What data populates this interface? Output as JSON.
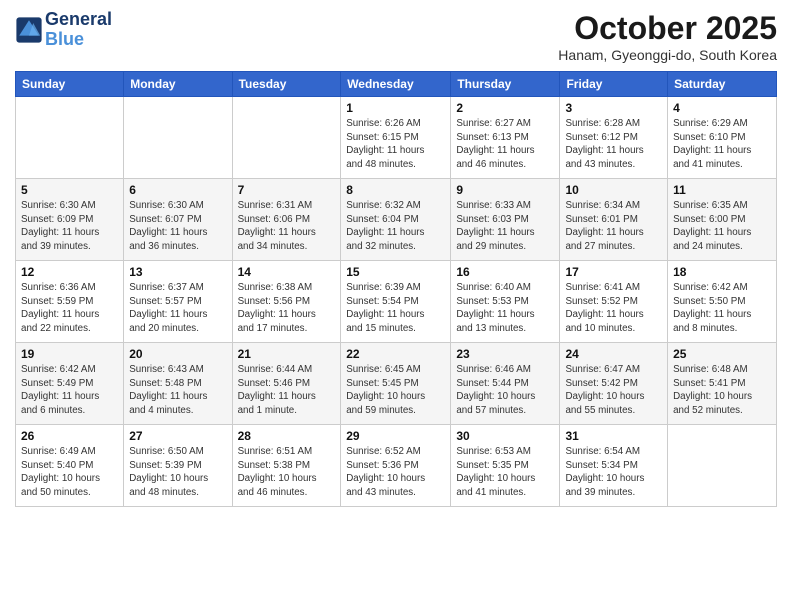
{
  "header": {
    "logo_line1": "General",
    "logo_line2": "Blue",
    "month_title": "October 2025",
    "subtitle": "Hanam, Gyeonggi-do, South Korea"
  },
  "days_of_week": [
    "Sunday",
    "Monday",
    "Tuesday",
    "Wednesday",
    "Thursday",
    "Friday",
    "Saturday"
  ],
  "weeks": [
    [
      {
        "day": "",
        "info": ""
      },
      {
        "day": "",
        "info": ""
      },
      {
        "day": "",
        "info": ""
      },
      {
        "day": "1",
        "info": "Sunrise: 6:26 AM\nSunset: 6:15 PM\nDaylight: 11 hours\nand 48 minutes."
      },
      {
        "day": "2",
        "info": "Sunrise: 6:27 AM\nSunset: 6:13 PM\nDaylight: 11 hours\nand 46 minutes."
      },
      {
        "day": "3",
        "info": "Sunrise: 6:28 AM\nSunset: 6:12 PM\nDaylight: 11 hours\nand 43 minutes."
      },
      {
        "day": "4",
        "info": "Sunrise: 6:29 AM\nSunset: 6:10 PM\nDaylight: 11 hours\nand 41 minutes."
      }
    ],
    [
      {
        "day": "5",
        "info": "Sunrise: 6:30 AM\nSunset: 6:09 PM\nDaylight: 11 hours\nand 39 minutes."
      },
      {
        "day": "6",
        "info": "Sunrise: 6:30 AM\nSunset: 6:07 PM\nDaylight: 11 hours\nand 36 minutes."
      },
      {
        "day": "7",
        "info": "Sunrise: 6:31 AM\nSunset: 6:06 PM\nDaylight: 11 hours\nand 34 minutes."
      },
      {
        "day": "8",
        "info": "Sunrise: 6:32 AM\nSunset: 6:04 PM\nDaylight: 11 hours\nand 32 minutes."
      },
      {
        "day": "9",
        "info": "Sunrise: 6:33 AM\nSunset: 6:03 PM\nDaylight: 11 hours\nand 29 minutes."
      },
      {
        "day": "10",
        "info": "Sunrise: 6:34 AM\nSunset: 6:01 PM\nDaylight: 11 hours\nand 27 minutes."
      },
      {
        "day": "11",
        "info": "Sunrise: 6:35 AM\nSunset: 6:00 PM\nDaylight: 11 hours\nand 24 minutes."
      }
    ],
    [
      {
        "day": "12",
        "info": "Sunrise: 6:36 AM\nSunset: 5:59 PM\nDaylight: 11 hours\nand 22 minutes."
      },
      {
        "day": "13",
        "info": "Sunrise: 6:37 AM\nSunset: 5:57 PM\nDaylight: 11 hours\nand 20 minutes."
      },
      {
        "day": "14",
        "info": "Sunrise: 6:38 AM\nSunset: 5:56 PM\nDaylight: 11 hours\nand 17 minutes."
      },
      {
        "day": "15",
        "info": "Sunrise: 6:39 AM\nSunset: 5:54 PM\nDaylight: 11 hours\nand 15 minutes."
      },
      {
        "day": "16",
        "info": "Sunrise: 6:40 AM\nSunset: 5:53 PM\nDaylight: 11 hours\nand 13 minutes."
      },
      {
        "day": "17",
        "info": "Sunrise: 6:41 AM\nSunset: 5:52 PM\nDaylight: 11 hours\nand 10 minutes."
      },
      {
        "day": "18",
        "info": "Sunrise: 6:42 AM\nSunset: 5:50 PM\nDaylight: 11 hours\nand 8 minutes."
      }
    ],
    [
      {
        "day": "19",
        "info": "Sunrise: 6:42 AM\nSunset: 5:49 PM\nDaylight: 11 hours\nand 6 minutes."
      },
      {
        "day": "20",
        "info": "Sunrise: 6:43 AM\nSunset: 5:48 PM\nDaylight: 11 hours\nand 4 minutes."
      },
      {
        "day": "21",
        "info": "Sunrise: 6:44 AM\nSunset: 5:46 PM\nDaylight: 11 hours\nand 1 minute."
      },
      {
        "day": "22",
        "info": "Sunrise: 6:45 AM\nSunset: 5:45 PM\nDaylight: 10 hours\nand 59 minutes."
      },
      {
        "day": "23",
        "info": "Sunrise: 6:46 AM\nSunset: 5:44 PM\nDaylight: 10 hours\nand 57 minutes."
      },
      {
        "day": "24",
        "info": "Sunrise: 6:47 AM\nSunset: 5:42 PM\nDaylight: 10 hours\nand 55 minutes."
      },
      {
        "day": "25",
        "info": "Sunrise: 6:48 AM\nSunset: 5:41 PM\nDaylight: 10 hours\nand 52 minutes."
      }
    ],
    [
      {
        "day": "26",
        "info": "Sunrise: 6:49 AM\nSunset: 5:40 PM\nDaylight: 10 hours\nand 50 minutes."
      },
      {
        "day": "27",
        "info": "Sunrise: 6:50 AM\nSunset: 5:39 PM\nDaylight: 10 hours\nand 48 minutes."
      },
      {
        "day": "28",
        "info": "Sunrise: 6:51 AM\nSunset: 5:38 PM\nDaylight: 10 hours\nand 46 minutes."
      },
      {
        "day": "29",
        "info": "Sunrise: 6:52 AM\nSunset: 5:36 PM\nDaylight: 10 hours\nand 43 minutes."
      },
      {
        "day": "30",
        "info": "Sunrise: 6:53 AM\nSunset: 5:35 PM\nDaylight: 10 hours\nand 41 minutes."
      },
      {
        "day": "31",
        "info": "Sunrise: 6:54 AM\nSunset: 5:34 PM\nDaylight: 10 hours\nand 39 minutes."
      },
      {
        "day": "",
        "info": ""
      }
    ]
  ]
}
